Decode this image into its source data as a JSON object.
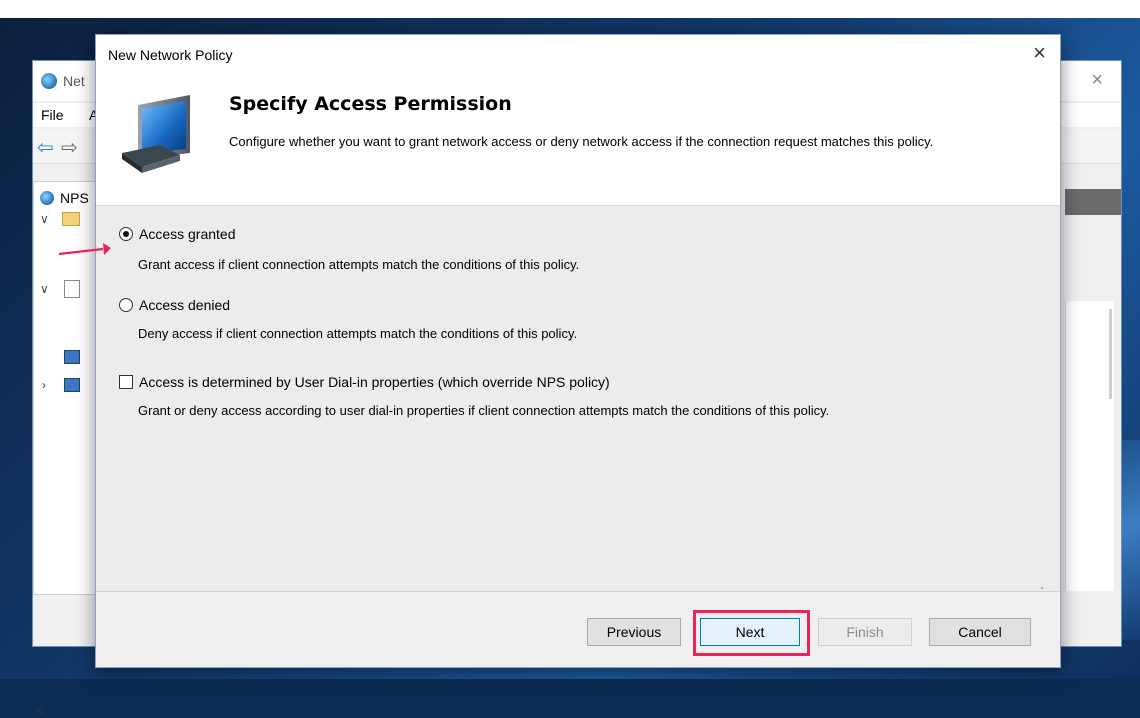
{
  "background_window": {
    "title_fragment": "Net",
    "menu": [
      "File",
      "A"
    ],
    "tree_root": "NPS",
    "scroll_left_glyph": "<"
  },
  "dialog": {
    "title": "New Network Policy",
    "close_glyph": "×",
    "header_title": "Specify Access Permission",
    "header_description": "Configure whether you want to grant network access or deny network access if the connection request matches this policy."
  },
  "options": [
    {
      "label": "Access granted",
      "description": "Grant access if client connection attempts match the conditions of this policy.",
      "type": "radio",
      "selected": true
    },
    {
      "label": "Access denied",
      "description": "Deny access if client connection attempts match the conditions of this policy.",
      "type": "radio",
      "selected": false
    },
    {
      "label": "Access is determined by User Dial-in properties (which override NPS policy)",
      "description": "Grant or deny access according to user dial-in properties if client connection attempts match the conditions of this policy.",
      "type": "checkbox",
      "checked": false
    }
  ],
  "buttons": {
    "previous": "Previous",
    "next": "Next",
    "finish": "Finish",
    "cancel": "Cancel"
  },
  "annotation": {
    "highlight_color": "#e8245a",
    "arrow_color": "#e8245a"
  }
}
